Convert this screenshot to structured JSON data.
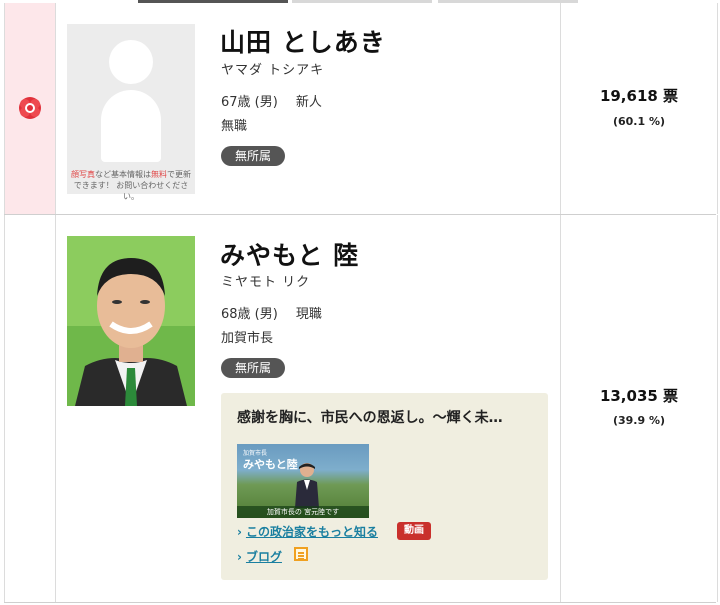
{
  "colors": {
    "winner_bg": "#fde7ea",
    "party_badge": "#555555",
    "link": "#1a7fa0",
    "video_badge": "#c9302c"
  },
  "candidates": [
    {
      "winner_icon": "rose-icon",
      "name": "山田 としあき",
      "kana": "ヤマダ トシアキ",
      "age_sex": "67歳 (男)",
      "status": "新人",
      "occupation": "無職",
      "party": "無所属",
      "photo_note_hl1": "顔写真",
      "photo_note_mid": "など基本情報は",
      "photo_note_hl2": "無料",
      "photo_note_end": "で更新",
      "photo_note_line2": "できます！ お問い合わせください。",
      "votes": "19,618 票",
      "percent": "(60.1 %)"
    },
    {
      "name": "みやもと 陸",
      "kana": "ミヤモト リク",
      "age_sex": "68歳 (男)",
      "status": "現職",
      "occupation": "加賀市長",
      "party": "無所属",
      "promo_title": "感謝を胸に、市民への恩返し。～輝く未…",
      "video_small": "加賀市長",
      "video_name": "みやもと陸",
      "video_caption": "加賀市長の 宮元陸です",
      "link_more": "この政治家をもっと知る",
      "video_badge": "動画",
      "link_blog": "ブログ",
      "votes": "13,035 票",
      "percent": "(39.9 %)"
    }
  ]
}
